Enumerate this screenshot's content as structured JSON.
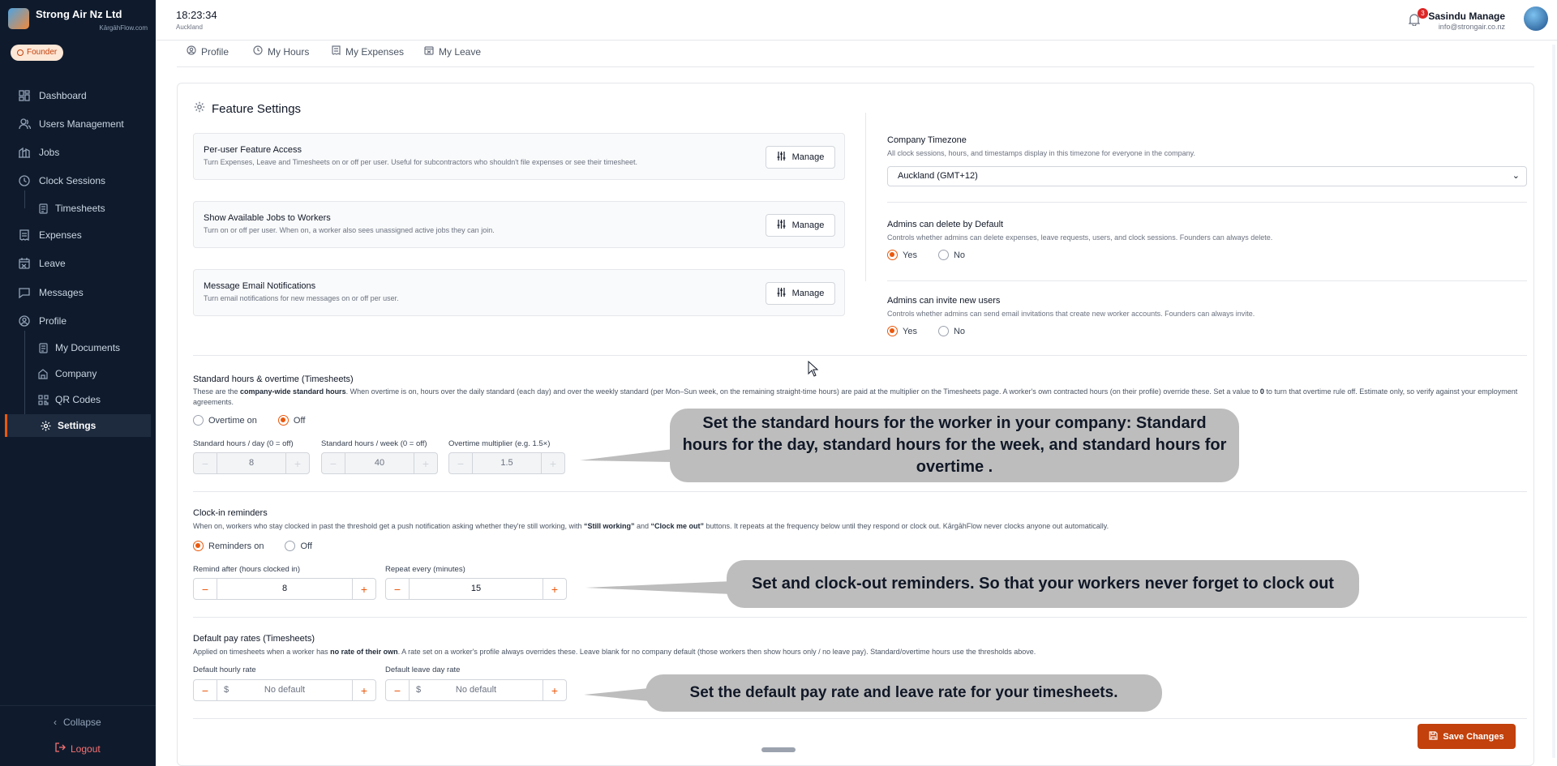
{
  "brand": {
    "name": "Strong Air Nz Ltd",
    "sub": "KārgāhFlow.com",
    "role": "Founder"
  },
  "nav": {
    "dashboard": "Dashboard",
    "users": "Users Management",
    "jobs": "Jobs",
    "clock_sessions": "Clock Sessions",
    "timesheets": "Timesheets",
    "expenses": "Expenses",
    "leave": "Leave",
    "messages": "Messages",
    "profile": "Profile",
    "my_documents": "My Documents",
    "company": "Company",
    "qr_codes": "QR Codes",
    "settings": "Settings",
    "collapse": "Collapse",
    "logout": "Logout"
  },
  "topbar": {
    "time": "18:23:34",
    "city": "Auckland",
    "notifications": "3",
    "user_name": "Sasindu Manage",
    "user_email": "info@strongair.co.nz"
  },
  "tabs": [
    "Profile",
    "My Hours",
    "My Expenses",
    "My Leave"
  ],
  "card": {
    "title": "Feature Settings",
    "features": [
      {
        "title": "Per-user Feature Access",
        "desc": "Turn Expenses, Leave and Timesheets on or off per user. Useful for subcontractors who shouldn't file expenses or see their timesheet.",
        "button": "Manage"
      },
      {
        "title": "Show Available Jobs to Workers",
        "desc": "Turn on or off per user. When on, a worker also sees unassigned active jobs they can join.",
        "button": "Manage"
      },
      {
        "title": "Message Email Notifications",
        "desc": "Turn email notifications for new messages on or off per user.",
        "button": "Manage"
      }
    ],
    "timezone": {
      "title": "Company Timezone",
      "desc": "All clock sessions, hours, and timestamps display in this timezone for everyone in the company.",
      "value": "Auckland (GMT+12)"
    },
    "admin_delete": {
      "title": "Admins can delete by Default",
      "desc": "Controls whether admins can delete expenses, leave requests, users, and clock sessions. Founders can always delete.",
      "yes": "Yes",
      "no": "No",
      "selected": "Yes"
    },
    "admin_invite": {
      "title": "Admins can invite new users",
      "desc": "Controls whether admins can send email invitations that create new worker accounts. Founders can always invite.",
      "yes": "Yes",
      "no": "No",
      "selected": "Yes"
    },
    "standard_hours": {
      "title": "Standard hours & overtime (Timesheets)",
      "desc_pre": "These are the ",
      "desc_bold": "company-wide standard hours",
      "desc_mid": ". When overtime is on, hours over the daily standard (each day) and over the weekly standard (per Mon–Sun week, on the remaining straight-time hours) are paid at the multiplier on the Timesheets page. A worker's own contracted hours (on their profile) override these. Set a value to ",
      "desc_zero": "0",
      "desc_post": " to turn that overtime rule off. Estimate only, so verify against your employment agreements.",
      "overtime_on": "Overtime on",
      "off": "Off",
      "selected": "Off",
      "day_label": "Standard hours / day (0 = off)",
      "day_value": "8",
      "week_label": "Standard hours / week (0 = off)",
      "week_value": "40",
      "mult_label": "Overtime multiplier (e.g. 1.5×)",
      "mult_value": "1.5"
    },
    "reminders": {
      "title": "Clock-in reminders",
      "desc_pre": "When on, workers who stay clocked in past the threshold get a push notification asking whether they're still working, with ",
      "desc_b1": "“Still working”",
      "desc_and": " and ",
      "desc_b2": "“Clock me out”",
      "desc_post": " buttons. It repeats at the frequency below until they respond or clock out. KārgāhFlow never clocks anyone out automatically.",
      "on": "Reminders on",
      "off": "Off",
      "selected": "Reminders on",
      "remind_label": "Remind after (hours clocked in)",
      "remind_value": "8",
      "repeat_label": "Repeat every (minutes)",
      "repeat_value": "15"
    },
    "pay_rates": {
      "title": "Default pay rates (Timesheets)",
      "desc_pre": "Applied on timesheets when a worker has ",
      "desc_bold": "no rate of their own",
      "desc_post": ". A rate set on a worker's profile always overrides these. Leave blank for no company default (those workers then show hours only / no leave pay). Standard/overtime hours use the thresholds above.",
      "hourly_label": "Default hourly rate",
      "leave_label": "Default leave day rate",
      "currency": "$",
      "placeholder": "No default"
    },
    "save": "Save Changes"
  },
  "callouts": {
    "hours": "Set the standard hours for the worker in your company: Standard hours for the day, standard hours for the week, and standard hours for overtime .",
    "reminders": "Set and clock-out reminders. So that your workers never forget to clock out",
    "pay": "Set the default pay rate and leave rate for your timesheets."
  },
  "colors": {
    "accent": "#ea580c",
    "sidebar": "#0f1b2d",
    "save": "#c2410c",
    "callout": "#bdbdbd"
  },
  "icons": [
    "dashboard-icon",
    "users-icon",
    "jobs-icon",
    "clock-icon",
    "timesheet-icon",
    "expenses-icon",
    "leave-icon",
    "messages-icon",
    "profile-icon",
    "documents-icon",
    "company-icon",
    "qr-icon",
    "settings-icon",
    "bell-icon",
    "sliders-icon",
    "save-icon"
  ]
}
